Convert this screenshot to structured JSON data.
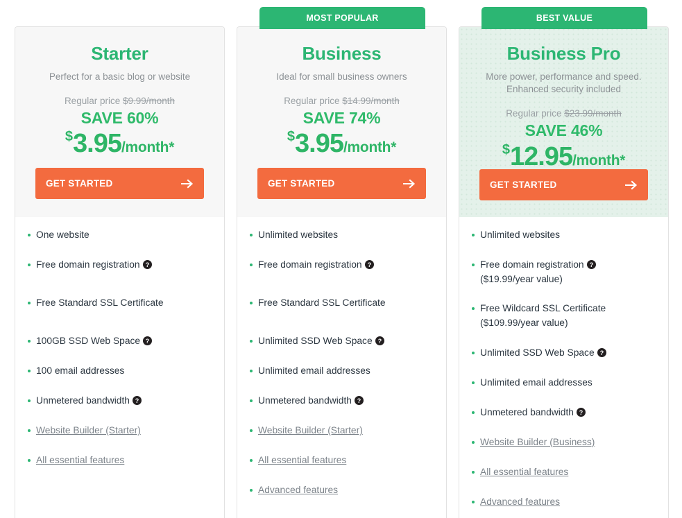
{
  "plans": [
    {
      "ribbon": null,
      "name": "Starter",
      "tagline": "Perfect for a basic blog or website",
      "regular_label": "Regular price",
      "regular_price": "$9.99/month",
      "save": "SAVE 60%",
      "currency": "$",
      "amount": "3.95",
      "period": "/month*",
      "cta": "GET STARTED",
      "featured": false,
      "features": [
        {
          "text": "One website",
          "help": false,
          "link": false,
          "gap": "gap-md"
        },
        {
          "text": "Free domain registration",
          "help": true,
          "link": false,
          "gap": "gap-lg"
        },
        {
          "text": "Free Standard SSL Certificate",
          "help": false,
          "link": false,
          "gap": "gap-lg"
        },
        {
          "text": "100GB SSD Web Space",
          "help": true,
          "link": false,
          "gap": "gap-md"
        },
        {
          "text": "100 email addresses",
          "help": false,
          "link": false,
          "gap": "gap-md"
        },
        {
          "text": "Unmetered bandwidth",
          "help": true,
          "link": false,
          "gap": "gap-md"
        },
        {
          "text": "Website Builder (Starter)",
          "help": false,
          "link": true,
          "gap": "gap-md"
        },
        {
          "text": "All essential features",
          "help": false,
          "link": true,
          "gap": "gap-md"
        }
      ]
    },
    {
      "ribbon": "MOST POPULAR",
      "name": "Business",
      "tagline": "Ideal for small business owners",
      "regular_label": "Regular price",
      "regular_price": "$14.99/month",
      "save": "SAVE 74%",
      "currency": "$",
      "amount": "3.95",
      "period": "/month*",
      "cta": "GET STARTED",
      "featured": false,
      "features": [
        {
          "text": "Unlimited websites",
          "help": false,
          "link": false,
          "gap": "gap-md"
        },
        {
          "text": "Free domain registration",
          "help": true,
          "link": false,
          "gap": "gap-lg"
        },
        {
          "text": "Free Standard SSL Certificate",
          "help": false,
          "link": false,
          "gap": "gap-lg"
        },
        {
          "text": "Unlimited SSD Web Space",
          "help": true,
          "link": false,
          "gap": "gap-md"
        },
        {
          "text": "Unlimited email addresses",
          "help": false,
          "link": false,
          "gap": "gap-md"
        },
        {
          "text": "Unmetered bandwidth",
          "help": true,
          "link": false,
          "gap": "gap-md"
        },
        {
          "text": "Website Builder (Starter)",
          "help": false,
          "link": true,
          "gap": "gap-md"
        },
        {
          "text": "All essential features",
          "help": false,
          "link": true,
          "gap": "gap-md"
        },
        {
          "text": "Advanced features",
          "help": false,
          "link": true,
          "gap": "gap-md"
        }
      ]
    },
    {
      "ribbon": "BEST VALUE",
      "name": "Business Pro",
      "tagline": "More power, performance and speed. Enhanced security included",
      "regular_label": "Regular price",
      "regular_price": "$23.99/month",
      "save": "SAVE 46%",
      "currency": "$",
      "amount": "12.95",
      "period": "/month*",
      "cta": "GET STARTED",
      "featured": true,
      "features": [
        {
          "text": "Unlimited websites",
          "help": false,
          "link": false,
          "gap": "gap-md"
        },
        {
          "text": "Free domain registration",
          "help": true,
          "link": false,
          "sub": "($19.99/year value)",
          "gap": "gap-md"
        },
        {
          "text": "Free Wildcard SSL Certificate",
          "help": false,
          "link": false,
          "sub": "($109.99/year value)",
          "gap": "gap-md"
        },
        {
          "text": "Unlimited SSD Web Space",
          "help": true,
          "link": false,
          "gap": "gap-md"
        },
        {
          "text": "Unlimited email addresses",
          "help": false,
          "link": false,
          "gap": "gap-md"
        },
        {
          "text": "Unmetered bandwidth",
          "help": true,
          "link": false,
          "gap": "gap-md"
        },
        {
          "text": "Website Builder (Business)",
          "help": false,
          "link": true,
          "gap": "gap-md"
        },
        {
          "text": "All essential features",
          "help": false,
          "link": true,
          "gap": "gap-md"
        },
        {
          "text": "Advanced features",
          "help": false,
          "link": true,
          "gap": "gap-md"
        }
      ]
    }
  ],
  "icons": {
    "help": "help-circle-icon",
    "arrow": "arrow-right-icon"
  },
  "colors": {
    "brand_green": "#2cb673",
    "price_green": "#2eb566",
    "cta_orange": "#f36b3f",
    "featured_bg": "#e4f1ea",
    "head_bg": "#f7f7f7",
    "text_dark": "#2b3640",
    "text_muted": "#8d9296",
    "link_gray": "#7c838a"
  }
}
